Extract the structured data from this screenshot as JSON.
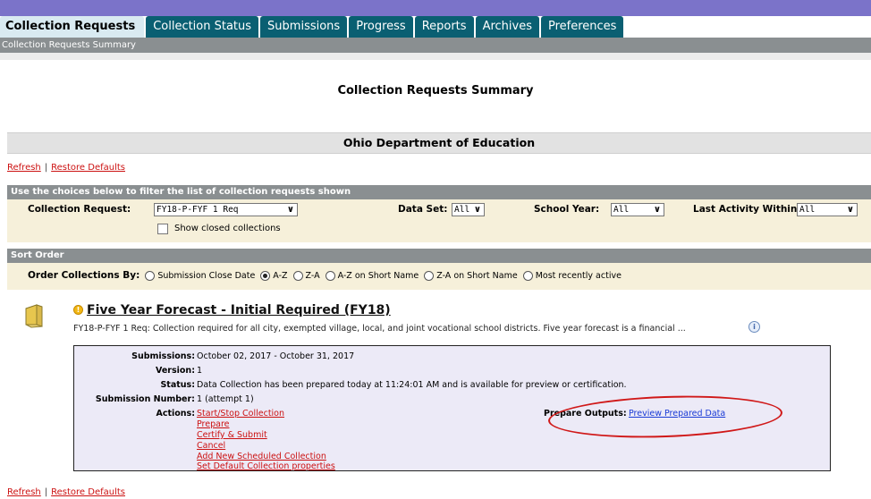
{
  "tabs": [
    {
      "label": "Collection Requests",
      "active": true
    },
    {
      "label": "Collection Status"
    },
    {
      "label": "Submissions"
    },
    {
      "label": "Progress"
    },
    {
      "label": "Reports"
    },
    {
      "label": "Archives"
    },
    {
      "label": "Preferences"
    }
  ],
  "subnav": "Collection Requests Summary",
  "page_title": "Collection Requests Summary",
  "organization": "Ohio Department of Education",
  "links": {
    "refresh": "Refresh",
    "separator": "|",
    "restore": "Restore Defaults"
  },
  "filter": {
    "heading": "Use the choices below to filter the list of collection requests shown",
    "collection_request_label": "Collection Request:",
    "collection_request_value": "FY18-P-FYF 1 Req",
    "show_closed_label": "Show closed collections",
    "data_set_label": "Data Set:",
    "data_set_value": "All",
    "school_year_label": "School Year:",
    "school_year_value": "All",
    "last_activity_label": "Last Activity Within:",
    "last_activity_value": "All"
  },
  "sort": {
    "heading": "Sort Order",
    "order_label": "Order Collections By:",
    "options": [
      "Submission Close Date",
      "A-Z",
      "Z-A",
      "A-Z on Short Name",
      "Z-A on Short Name",
      "Most recently active"
    ],
    "selected": "A-Z"
  },
  "request": {
    "title": "Five Year Forecast - Initial Required (FY18)",
    "description": "FY18-P-FYF 1 Req: Collection required for all city, exempted village, local, and joint vocational school districts. Five year forecast is a financial ...",
    "submissions_label": "Submissions:",
    "submissions_value": "October 02, 2017 - October 31, 2017",
    "version_label": "Version:",
    "version_value": "1",
    "status_label": "Status:",
    "status_value": "Data Collection has been prepared today at 11:24:01 AM and is available for preview or certification.",
    "submission_number_label": "Submission Number:",
    "submission_number_value": "1 (attempt 1)",
    "actions_label": "Actions:",
    "actions": [
      "Start/Stop Collection",
      "Prepare",
      "Certify & Submit",
      "Cancel",
      "Add New Scheduled Collection",
      "Set Default Collection properties"
    ],
    "prepare_outputs_label": "Prepare Outputs:",
    "prepare_outputs_link": "Preview Prepared Data"
  },
  "colors": {
    "tab_bg": "#0a5f72",
    "tab_active_bg": "#d9eaf1",
    "top_strip": "#7b73c9",
    "header_gray": "#8a8f91",
    "filter_bg": "#f6f0da",
    "detail_bg": "#eceaf7",
    "link_red": "#c11",
    "link_blue": "#1a3bd6",
    "annotation_red": "#d01818"
  }
}
